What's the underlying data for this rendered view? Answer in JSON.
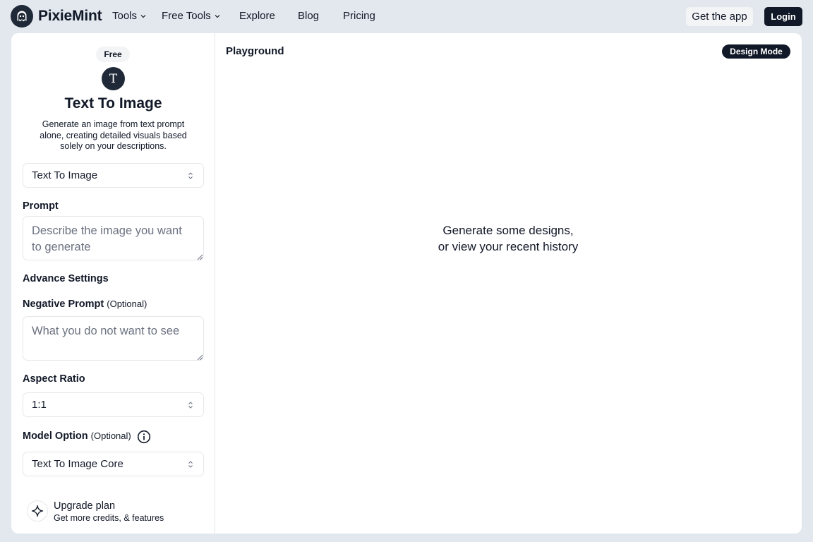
{
  "header": {
    "brand": "PixieMint",
    "nav": [
      {
        "label": "Tools",
        "dropdown": true
      },
      {
        "label": "Free Tools",
        "dropdown": true
      },
      {
        "label": "Explore",
        "dropdown": false
      },
      {
        "label": "Blog",
        "dropdown": false
      },
      {
        "label": "Pricing",
        "dropdown": false
      }
    ],
    "get_app_label": "Get the app",
    "login_label": "Login"
  },
  "sidebar": {
    "badge": "Free",
    "tool_icon_letter": "T",
    "title": "Text To Image",
    "description": "Generate an image from text prompt alone, creating detailed visuals based solely on your descriptions.",
    "mode_select": {
      "value": "Text To Image"
    },
    "prompt": {
      "label": "Prompt",
      "placeholder": "Describe the image you want to generate"
    },
    "advanced_label": "Advance Settings",
    "negative_prompt": {
      "label": "Negative Prompt",
      "optional": "(Optional)",
      "placeholder": "What you do not want to see"
    },
    "aspect_ratio": {
      "label": "Aspect Ratio",
      "value": "1:1"
    },
    "model_option": {
      "label": "Model Option",
      "optional": "(Optional)",
      "value": "Text To Image Core"
    },
    "upgrade": {
      "title": "Upgrade plan",
      "subtitle": "Get more credits, & features"
    }
  },
  "playground": {
    "title": "Playground",
    "design_mode_label": "Design Mode",
    "empty_line1": "Generate some designs,",
    "empty_line2": "or view your recent history"
  },
  "icons": {
    "logo": "ghost-logo-icon",
    "dropdown": "chevron-down-icon",
    "select": "chevron-up-down-icon",
    "info": "info-icon",
    "upgrade": "sparkle-icon"
  },
  "colors": {
    "page_bg": "#e3e8ef",
    "card_bg": "#ffffff",
    "dark": "#111827",
    "placeholder": "#6b7280",
    "border": "#e5e7eb"
  }
}
